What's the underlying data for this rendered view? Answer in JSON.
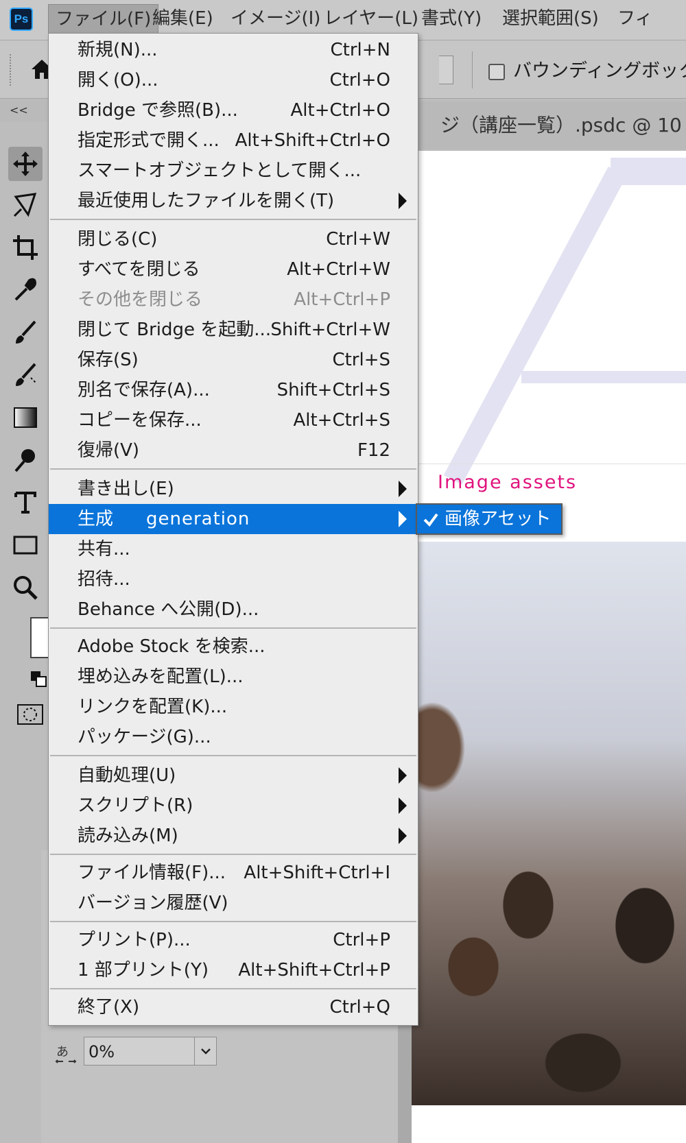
{
  "app": {
    "logo_text": "Ps",
    "brand_color": "#31a8ff"
  },
  "menubar": {
    "items": [
      {
        "label": "ファイル(F)",
        "active": true
      },
      {
        "label": "編集(E)"
      },
      {
        "label": "イメージ(I)"
      },
      {
        "label": "レイヤー(L)"
      },
      {
        "label": "書式(Y)"
      },
      {
        "label": "選択範囲(S)"
      },
      {
        "label": "フィ"
      }
    ]
  },
  "options_bar": {
    "home_icon": "home-icon",
    "bounding_box_label": "バウンディングボックス",
    "bounding_box_checked": false
  },
  "toolbar": {
    "collapse_label": "<<",
    "tools": [
      "move-icon",
      "lasso-icon",
      "crop-icon",
      "eyedropper-icon",
      "brush-icon",
      "healing-brush-icon",
      "gradient-icon",
      "dodge-icon",
      "type-icon",
      "rectangle-icon",
      "zoom-icon"
    ]
  },
  "document": {
    "tab_title": "ジ（講座一覧）.psdc @ 10"
  },
  "file_menu": {
    "items": [
      {
        "label": "新規(N)...",
        "shortcut": "Ctrl+N"
      },
      {
        "label": "開く(O)...",
        "shortcut": "Ctrl+O"
      },
      {
        "label": "Bridge で参照(B)...",
        "shortcut": "Alt+Ctrl+O"
      },
      {
        "label": "指定形式で開く...",
        "shortcut": "Alt+Shift+Ctrl+O"
      },
      {
        "label": "スマートオブジェクトとして開く...",
        "shortcut": ""
      },
      {
        "label": "最近使用したファイルを開く(T)",
        "shortcut": "",
        "submenu": true
      },
      {
        "label": "閉じる(C)",
        "shortcut": "Ctrl+W"
      },
      {
        "label": "すべてを閉じる",
        "shortcut": "Alt+Ctrl+W"
      },
      {
        "label": "その他を閉じる",
        "shortcut": "Alt+Ctrl+P",
        "disabled": true
      },
      {
        "label": "閉じて Bridge を起動...",
        "shortcut": "Shift+Ctrl+W"
      },
      {
        "label": "保存(S)",
        "shortcut": "Ctrl+S"
      },
      {
        "label": "別名で保存(A)...",
        "shortcut": "Shift+Ctrl+S"
      },
      {
        "label": "コピーを保存...",
        "shortcut": "Alt+Ctrl+S"
      },
      {
        "label": "復帰(V)",
        "shortcut": "F12"
      },
      {
        "label": "書き出し(E)",
        "shortcut": "",
        "submenu": true
      },
      {
        "label": "生成",
        "shortcut": "",
        "submenu": true,
        "highlighted": true,
        "annotation": "generation"
      },
      {
        "label": "共有...",
        "shortcut": ""
      },
      {
        "label": "招待...",
        "shortcut": ""
      },
      {
        "label": "Behance へ公開(D)...",
        "shortcut": ""
      },
      {
        "label": "Adobe Stock を検索...",
        "shortcut": ""
      },
      {
        "label": "埋め込みを配置(L)...",
        "shortcut": ""
      },
      {
        "label": "リンクを配置(K)...",
        "shortcut": ""
      },
      {
        "label": "パッケージ(G)...",
        "shortcut": ""
      },
      {
        "label": "自動処理(U)",
        "shortcut": "",
        "submenu": true
      },
      {
        "label": "スクリプト(R)",
        "shortcut": "",
        "submenu": true
      },
      {
        "label": "読み込み(M)",
        "shortcut": "",
        "submenu": true
      },
      {
        "label": "ファイル情報(F)...",
        "shortcut": "Alt+Shift+Ctrl+I"
      },
      {
        "label": "バージョン履歴(V)",
        "shortcut": ""
      },
      {
        "label": "プリント(P)...",
        "shortcut": "Ctrl+P"
      },
      {
        "label": "1 部プリント(Y)",
        "shortcut": "Alt+Shift+Ctrl+P"
      },
      {
        "label": "終了(X)",
        "shortcut": "Ctrl+Q"
      }
    ]
  },
  "submenu": {
    "annotation": "Image assets",
    "item": {
      "label": "画像アセット",
      "checked": true
    }
  },
  "properties": {
    "tracking_icon": "tracking-icon",
    "tracking_value": "0%"
  },
  "colors": {
    "highlight": "#0a74da",
    "annotation": "#e0137e",
    "disabled_text": "#8d8d8d"
  }
}
